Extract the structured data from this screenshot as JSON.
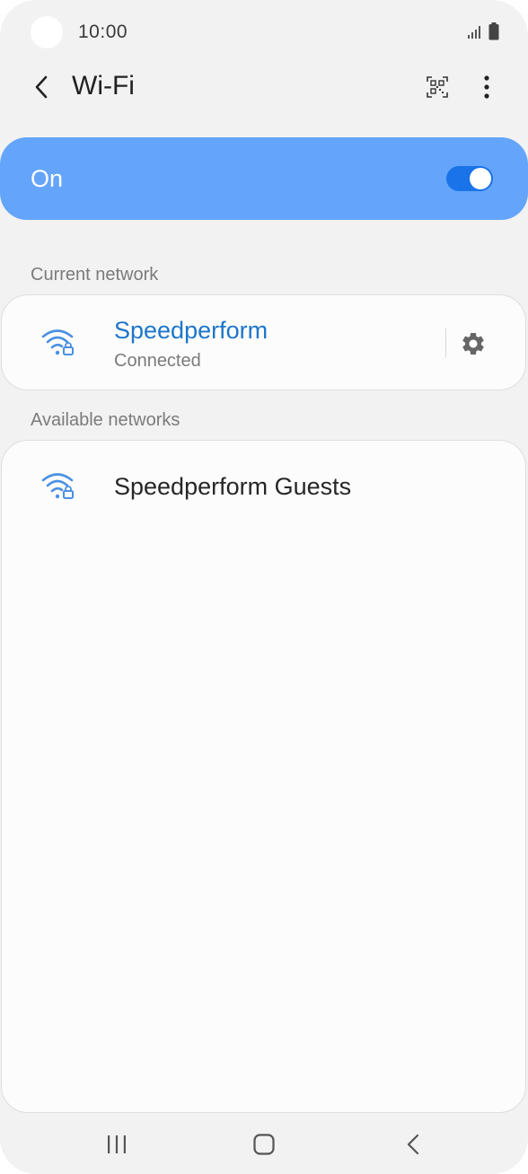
{
  "status_bar": {
    "time": "10:00",
    "icons": [
      "signal-icon",
      "battery-icon"
    ]
  },
  "app_bar": {
    "title": "Wi-Fi",
    "icons": [
      "back-arrow-icon",
      "qr-code-icon",
      "more-options-icon"
    ]
  },
  "wifi_toggle": {
    "label": "On",
    "enabled": true,
    "colors": {
      "card": "#64a5fb",
      "switch_track": "#1a73e8",
      "switch_knob": "#ffffff"
    }
  },
  "current_network": {
    "header": "Current network",
    "name": "Speedperform",
    "status": "Connected",
    "icons": [
      "wifi-secured-icon",
      "settings-gear-icon"
    ],
    "name_color": "#1d76c9"
  },
  "available_networks": {
    "header": "Available networks",
    "items": [
      {
        "name": "Speedperform Guests",
        "icon": "wifi-secured-icon"
      }
    ]
  },
  "nav_bar": {
    "icons": [
      "recents-icon",
      "home-icon",
      "back-icon"
    ]
  },
  "colors": {
    "background": "#f2f2f2",
    "card": "#fcfcfc",
    "wifi_icon": "#4a90e2",
    "section_header": "#7b7b7b"
  }
}
